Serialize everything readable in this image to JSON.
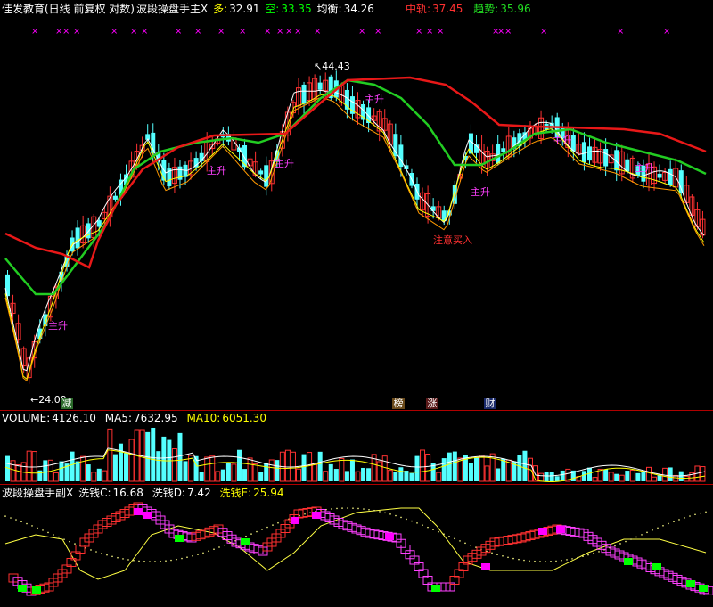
{
  "main_header": {
    "name": "佳发教育(日线 前复权 对数)",
    "indicator": "波段操盘手主X",
    "duo_label": "多:",
    "duo_value": "32.91",
    "kong_label": "空:",
    "kong_value": "33.35",
    "junheng_label": "均衡:",
    "junheng_value": "34.26",
    "zhongui_label": "中轨:",
    "zhongui_value": "37.45",
    "qushi_label": "趋势:",
    "qushi_value": "35.96"
  },
  "volume_header": {
    "volume_label": "VOLUME:",
    "volume_value": "4126.10",
    "ma5_label": "MA5:",
    "ma5_value": "7632.95",
    "ma10_label": "MA10:",
    "ma10_value": "6051.30"
  },
  "sub_header": {
    "indicator": "波段操盘手副X",
    "c_label": "洗钱C:",
    "c_value": "16.68",
    "d_label": "洗钱D:",
    "d_value": "7.42",
    "e_label": "洗钱E:",
    "e_value": "25.94"
  },
  "annotations": {
    "high_label": "44.43",
    "low_label": "24.09",
    "buy_signal": "注意买入",
    "rise_label": "主升",
    "x_mark": "×",
    "marker_jian": "减",
    "marker_bang": "榜",
    "marker_zhang": "涨",
    "marker_cai": "财"
  },
  "colors": {
    "up": "#ff3232",
    "down": "#54ffff",
    "zhongui": "#e81818",
    "qushi": "#22cc22",
    "duo": "#ffff00",
    "kong": "#00ff00",
    "magenta": "#ff00ff",
    "header_gray": "#ffffff"
  },
  "chart_data": [
    {
      "type": "candlestick",
      "title": "佳发教育(日线 前复权 对数)",
      "scale": "log",
      "ylim": [
        23.5,
        46.5
      ],
      "series": [
        {
          "name": "中轨",
          "value_last": 37.45
        },
        {
          "name": "趋势",
          "value_last": 35.96
        },
        {
          "name": "多",
          "value_last": 32.91
        },
        {
          "name": "空",
          "value_last": 33.35
        },
        {
          "name": "均衡",
          "value_last": 34.26
        }
      ],
      "annotations": [
        {
          "text": "44.43",
          "kind": "period-high"
        },
        {
          "text": "24.09",
          "kind": "period-low"
        },
        {
          "text": "注意买入",
          "kind": "signal"
        }
      ]
    },
    {
      "type": "bar",
      "title": "VOLUME",
      "series": [
        {
          "name": "VOLUME",
          "value_last": 4126.1
        },
        {
          "name": "MA5",
          "value_last": 7632.95
        },
        {
          "name": "MA10",
          "value_last": 6051.3
        }
      ]
    },
    {
      "type": "line",
      "title": "波段操盘手副X",
      "series": [
        {
          "name": "洗钱C",
          "value_last": 16.68
        },
        {
          "name": "洗钱D",
          "value_last": 7.42
        },
        {
          "name": "洗钱E",
          "value_last": 25.94
        }
      ]
    }
  ]
}
